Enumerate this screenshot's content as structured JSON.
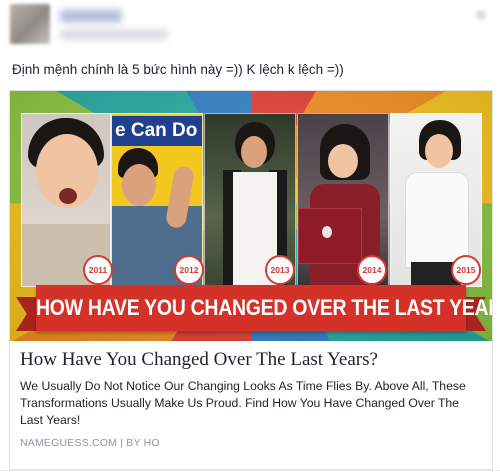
{
  "post": {
    "status_text": "Định mệnh chính là 5 bức hình này =)) K lệch k lệch =))"
  },
  "banner": {
    "top_sign_text": "e Can Do I",
    "years": [
      "2011",
      "2012",
      "2013",
      "2014",
      "2015"
    ],
    "ribbon_text": "HOW HAVE YOU CHANGED OVER THE LAST YEARS?",
    "colors": {
      "ribbon": "#d43228",
      "badge_ring": "#d23a34"
    }
  },
  "link": {
    "title": "How Have You Changed Over The Last Years?",
    "description": "We Usually Do Not Notice Our Changing Looks As Time Flies By. Above All, These Transformations Usually Make Us Proud. Find How You Have Changed Over The Last Years!",
    "meta": "NAMEGUESS.COM | BY HO"
  },
  "icons": [
    "avatar",
    "options-chevron-icon",
    "apple-logo-icon"
  ]
}
